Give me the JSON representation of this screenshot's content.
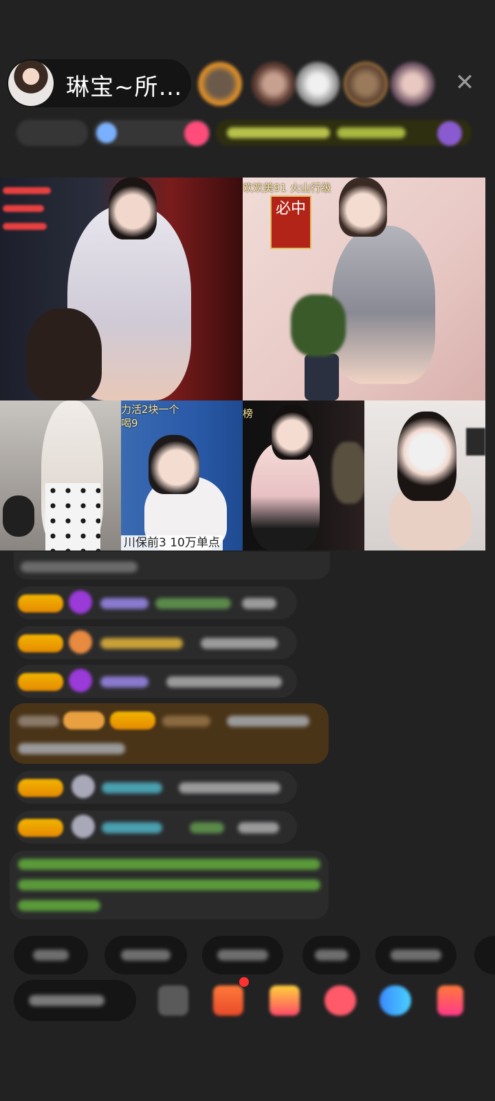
{
  "header": {
    "host_name": "琳宝~所…",
    "viewer_avatar_count": 5,
    "close_icon": "close-icon"
  },
  "video_grid": {
    "tiles": [
      {
        "id": "tl",
        "overlay": ""
      },
      {
        "id": "tr",
        "overlay": "欢欢美91 火山行级"
      },
      {
        "id": "bl1",
        "overlay": ""
      },
      {
        "id": "bl2",
        "overlay_top": "力活2块一个",
        "overlay_top2": "喝9",
        "overlay_bottom": "川保前3 10万单点"
      },
      {
        "id": "br1",
        "overlay": "榜"
      },
      {
        "id": "br2",
        "overlay": ""
      }
    ],
    "sticker_text": "必中"
  },
  "colors": {
    "background": "#222223",
    "badge_gold": "#f2b500",
    "highlight_row": "#5a3d1c",
    "green_message": "#5a9a3a"
  }
}
